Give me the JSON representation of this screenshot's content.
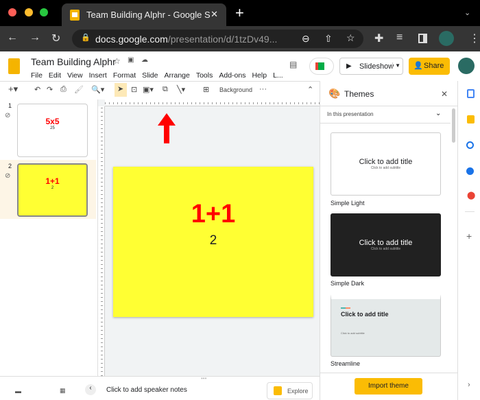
{
  "browser": {
    "tab_title": "Team Building Alphr - Google S",
    "new_tab": "+",
    "url_host": "docs.google.com",
    "url_path": "/presentation/d/1tzDv49..."
  },
  "doc": {
    "title": "Team Building Alphr",
    "menu": [
      "File",
      "Edit",
      "View",
      "Insert",
      "Format",
      "Slide",
      "Arrange",
      "Tools",
      "Add-ons",
      "Help",
      "L..."
    ],
    "slideshow_label": "Slideshow",
    "share_label": "Share"
  },
  "toolbar": {
    "background_label": "Background",
    "more": "···"
  },
  "slides": [
    {
      "num": "1",
      "title": "5x5",
      "body": "25"
    },
    {
      "num": "2",
      "title": "1+1",
      "body": "2"
    }
  ],
  "current_slide": {
    "title": "1+1",
    "body": "2"
  },
  "notes": {
    "placeholder": "Click to add speaker notes",
    "explore_label": "Explore"
  },
  "themes": {
    "title": "Themes",
    "filter": "In this presentation",
    "items": [
      {
        "name": "Simple Light",
        "title": "Click to add title",
        "subtitle": "Click to add subtitle"
      },
      {
        "name": "Simple Dark",
        "title": "Click to add title",
        "subtitle": "Click to add subtitle"
      },
      {
        "name": "Streamline",
        "title": "Click to add title",
        "subtitle": "Click to add subtitle"
      }
    ],
    "import_label": "Import theme"
  },
  "colors": {
    "accent": "#fbbc04",
    "slide_bg": "#ffff33",
    "slide_title": "#ff0000",
    "arrow": "#ff0000"
  }
}
